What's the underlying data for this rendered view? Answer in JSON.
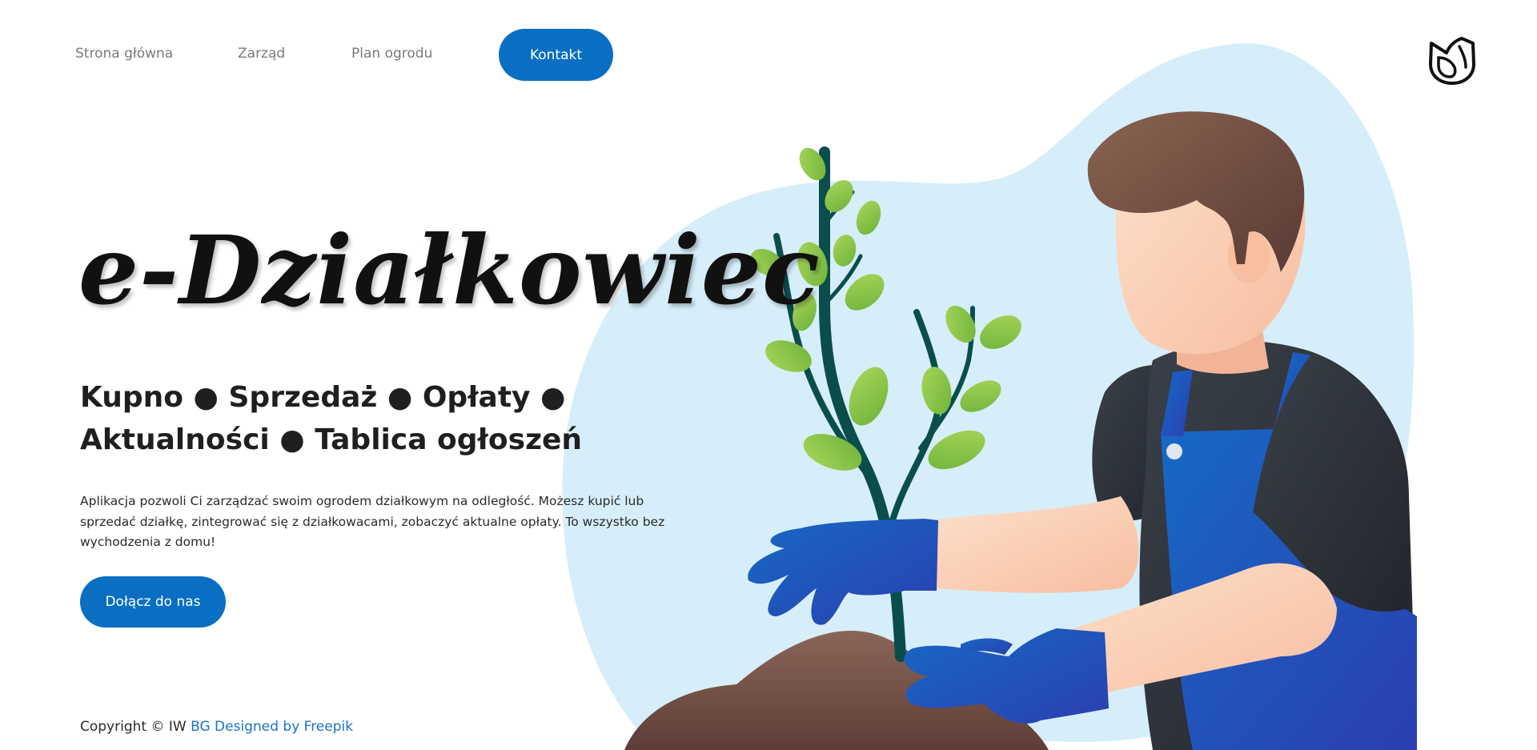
{
  "nav": {
    "links": [
      "Strona główna",
      "Zarząd",
      "Plan ogrodu"
    ],
    "contact_label": "Kontakt",
    "logo_icon": "tulip-logo-icon"
  },
  "hero": {
    "brand": "e-Działkowiec",
    "tagline_line1": "Kupno ● Sprzedaż ● Opłaty ●",
    "tagline_line2": "Aktualności ● Tablica ogłoszeń",
    "description": "Aplikacja pozwoli Ci zarządzać swoim ogrodem działkowym na odległość. Możesz kupić lub sprzedać działkę, zintegrować się z działkowacami, zobaczyć aktualne opłaty. To wszystko bez wychodzenia z domu!",
    "cta_label": "Dołącz do nas",
    "illustration": "gardener-planting-tree-illustration"
  },
  "footer": {
    "copyright": "Copyright © IW",
    "credit_link": "BG Designed by Freepik"
  },
  "colors": {
    "primary": "#0a6fc2",
    "blob": "#d6eef9",
    "leaf": "#8cc63f",
    "stem": "#0b4d4d",
    "overalls": "#1d5bc2",
    "shirt": "#2d333b",
    "skin": "#fbcfb4",
    "hair": "#7a5444",
    "soil": "#6e4c40",
    "link": "#1a73c8"
  }
}
